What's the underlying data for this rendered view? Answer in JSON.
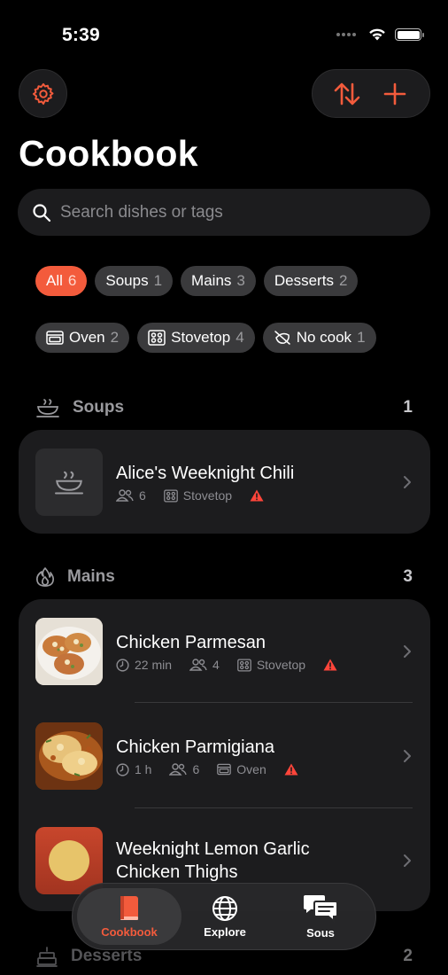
{
  "status": {
    "time": "5:39"
  },
  "header": {
    "title": "Cookbook"
  },
  "search": {
    "placeholder": "Search dishes or tags"
  },
  "category_filters": [
    {
      "label": "All",
      "count": "6",
      "active": true
    },
    {
      "label": "Soups",
      "count": "1"
    },
    {
      "label": "Mains",
      "count": "3"
    },
    {
      "label": "Desserts",
      "count": "2"
    }
  ],
  "method_filters": [
    {
      "label": "Oven",
      "count": "2",
      "icon": "oven-icon"
    },
    {
      "label": "Stovetop",
      "count": "4",
      "icon": "stovetop-icon"
    },
    {
      "label": "No cook",
      "count": "1",
      "icon": "no-cook-icon"
    }
  ],
  "sections": {
    "soups": {
      "title": "Soups",
      "count": "1",
      "recipes": [
        {
          "name": "Alice's Weeknight Chili",
          "servings": "6",
          "method": "Stovetop",
          "warning": true
        }
      ]
    },
    "mains": {
      "title": "Mains",
      "count": "3",
      "recipes": [
        {
          "name": "Chicken Parmesan",
          "time": "22 min",
          "servings": "4",
          "method": "Stovetop",
          "warning": true
        },
        {
          "name": "Chicken Parmigiana",
          "time": "1 h",
          "servings": "6",
          "method": "Oven",
          "warning": true
        },
        {
          "name_line1": "Weeknight Lemon Garlic",
          "name_line2": "Chicken Thighs"
        }
      ]
    },
    "desserts": {
      "title": "Desserts",
      "count": "2"
    }
  },
  "tabbar": {
    "cookbook": "Cookbook",
    "explore": "Explore",
    "sous": "Sous"
  },
  "colors": {
    "accent": "#f35b3c",
    "background": "#000000",
    "card": "#1c1c1e",
    "warning": "#ff453a"
  }
}
